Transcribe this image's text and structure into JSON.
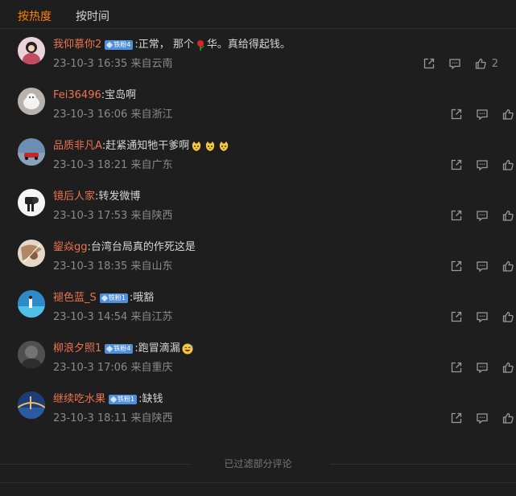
{
  "tabs": [
    {
      "label": "按热度",
      "active": true
    },
    {
      "label": "按时间",
      "active": false
    }
  ],
  "comments": [
    {
      "user": "我仰慕你2",
      "badge": "铁粉4",
      "text_parts": [
        ":正常， 那个",
        "华。真给得起钱。"
      ],
      "emoji_inline": "rose",
      "meta": "23-10-3 16:35 来自云南",
      "likes": "2"
    },
    {
      "user": "Fei36496",
      "badge": "",
      "text_parts": [
        ":宝岛啊"
      ],
      "meta": "23-10-3 16:06 来自浙江",
      "likes": ""
    },
    {
      "user": "品质非凡A",
      "badge": "",
      "text_parts": [
        ":赶紧通知牠干爹啊"
      ],
      "emoji_tail": 3,
      "meta": "23-10-3 18:21 来自广东",
      "likes": ""
    },
    {
      "user": "镜后人家",
      "badge": "",
      "text_parts": [
        ":转发微博"
      ],
      "meta": "23-10-3 17:53 来自陕西",
      "likes": ""
    },
    {
      "user": "鋆焱gg",
      "badge": "",
      "text_parts": [
        ":台湾台局真的作死这是"
      ],
      "meta": "23-10-3 18:35 来自山东",
      "likes": ""
    },
    {
      "user": "褪色蓝_S",
      "badge": "铁粉1",
      "text_parts": [
        ":哦豁"
      ],
      "meta": "23-10-3 14:54 来自江苏",
      "likes": ""
    },
    {
      "user": "柳浪夕照1",
      "badge": "铁粉4",
      "text_parts": [
        ":跑冒滴漏"
      ],
      "emoji_tail": 1,
      "meta": "23-10-3 17:06 来自重庆",
      "likes": ""
    },
    {
      "user": "继续吃水果",
      "badge": "铁粉1",
      "text_parts": [
        ":缺钱"
      ],
      "meta": "23-10-3 18:11 来自陕西",
      "likes": ""
    }
  ],
  "footer": {
    "text": "已过滤部分评论"
  },
  "colors": {
    "accent": "#ff8200",
    "username": "#eb7350",
    "badge": "#4f8fdc",
    "background": "#1e1e1e"
  },
  "icons": {
    "share": "share-icon",
    "comment": "comment-icon",
    "like": "thumbs-up-icon"
  }
}
